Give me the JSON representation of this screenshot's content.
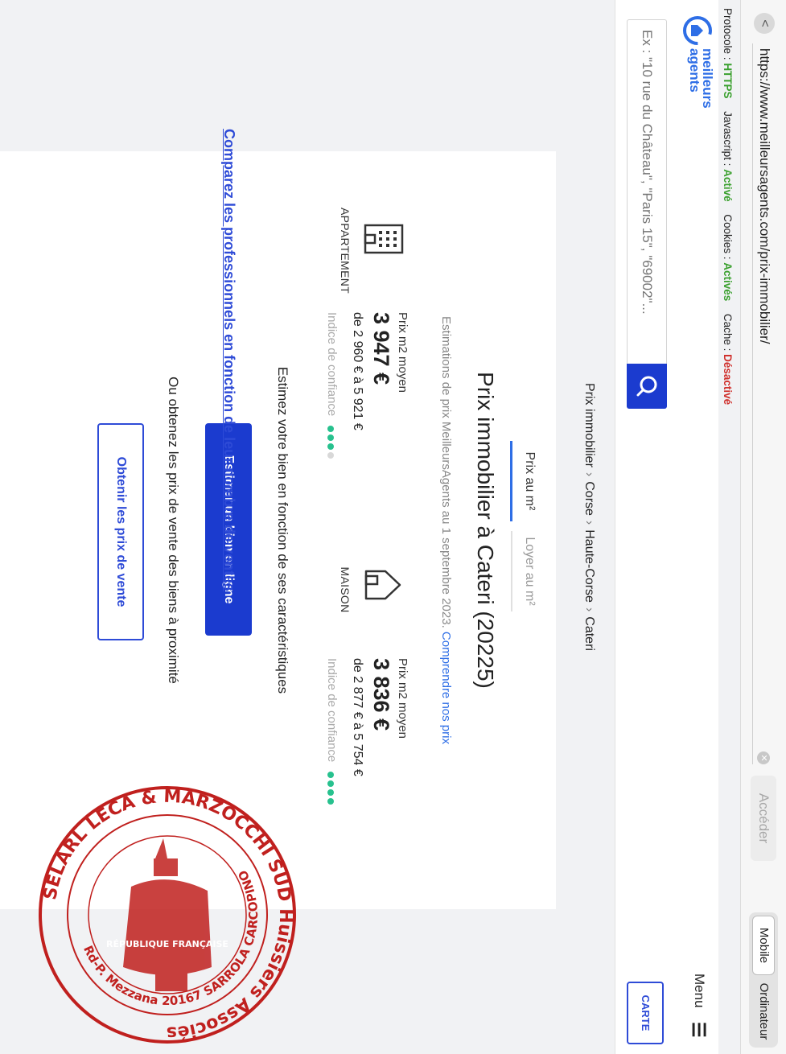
{
  "browser": {
    "back": "<",
    "url": "https://www.meilleursagents.com/prix-immobilier/",
    "go": "Accéder",
    "mode_mobile": "Mobile",
    "mode_desktop": "Ordinateur"
  },
  "status": {
    "protocol_label": "Protocole :",
    "protocol_value": "HTTPS",
    "js_label": "Javascript :",
    "js_value": "Activé",
    "cookies_label": "Cookies :",
    "cookies_value": "Activés",
    "cache_label": "Cache :",
    "cache_value": "Désactivé"
  },
  "header": {
    "logo_line1": "meilleurs",
    "logo_line2": "agents",
    "menu": "Menu"
  },
  "search": {
    "placeholder": "Ex : \"10 rue du Château\", \"Paris 15\", \"69002\"...",
    "map_button": "CARTE"
  },
  "breadcrumb": [
    "Prix immobilier",
    "Corse",
    "Haute-Corse",
    "Cateri"
  ],
  "tabs": [
    "Prix au m²",
    "Loyer au m²"
  ],
  "title": "Prix immobilier à Cateri (20225)",
  "subtitle": "Estimations de prix MeilleursAgents au 1 septembre 2023.",
  "subtitle_link": "Comprendre nos prix",
  "appartement": {
    "label": "APPARTEMENT",
    "caption": "Prix m2 moyen",
    "price": "3 947 €",
    "range": "de 2 960 € à 5 921 €",
    "confidence_label": "Indice de confiance",
    "confidence": 3
  },
  "maison": {
    "label": "MAISON",
    "caption": "Prix m2 moyen",
    "price": "3 836 €",
    "range": "de 2 877 € à 5 754 €",
    "confidence_label": "Indice de confiance",
    "confidence": 4
  },
  "estimate_text": "Estimez votre bien en fonction de ses caractéristiques",
  "estimate_button": "Estimer un bien en ligne",
  "sales_text": "Ou obtenez les prix de vente des biens à proximité",
  "sales_button": "Obtenir les prix de vente",
  "bottom_link": "Comparez les professionnels en fonction de leur nombre de ventes",
  "stamp": {
    "outer_text": "SELARL LECA & MARZOCCHI SUD Huissiers Associés",
    "inner_text": "Rd-P. Mezzana 20167 SARROLA CARCOPINO",
    "center_text": "RÉPUBLIQUE FRANÇAISE",
    "color": "#c0201e"
  }
}
